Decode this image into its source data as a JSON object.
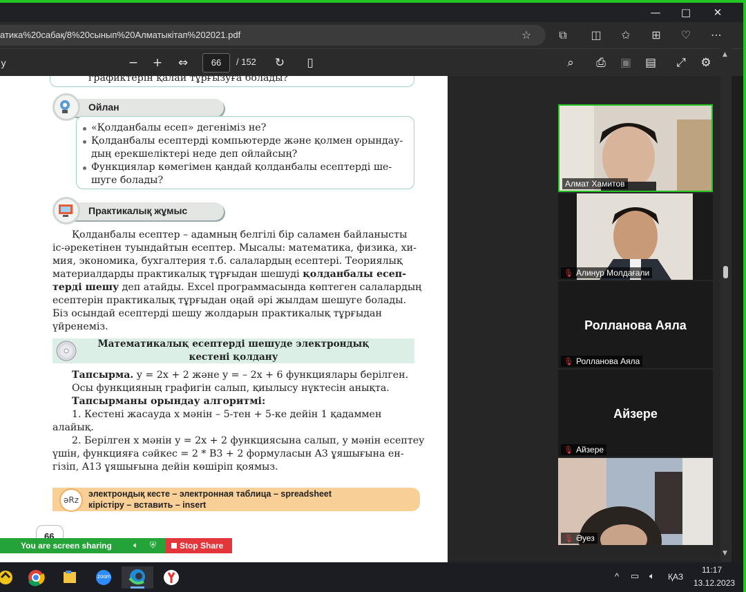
{
  "window": {
    "minimize": "—",
    "maximize": "□",
    "close": "✕"
  },
  "address_bar": {
    "url": "атика%20сабақ/8%20сынып%20Алматыкітап%202021.pdf"
  },
  "pdf_toolbar": {
    "page_current": "66",
    "page_total": "/ 152",
    "left_fragment": "y"
  },
  "document": {
    "top_fragment": "графиктерін қалай тұрғызуға болады?",
    "think_heading": "Ойлан",
    "questions": [
      "«Қолданбалы есеп» дегеніміз не?",
      "Қолданбалы есептерді компьютерде және қолмен орындау-",
      "дың ерекшеліктері неде деп ойлайсың?",
      "Функциялар көмегімен қандай қолданбалы есептерді ше-",
      "шуге болады?"
    ],
    "practical_heading": "Практикалық жұмыс",
    "paragraph": [
      "Қолданбалы есептер – адамның белгілі бір саламен байланысты",
      "іс-әрекетінен туындайтын есептер. Мысалы: математика, физика, хи-",
      "мия, экономика, бухгалтерия т.б. салалардың есептері. Теориялық",
      "материалдарды практикалық тұрғыдан шешуді",
      "қолданбалы есеп-",
      "терді шешу",
      "деп атайды. Excel программасында көптеген салалардың",
      "есептерін практикалық тұрғыдан оңай әрі жылдам шешуге болады.",
      "Біз осындай есептерді шешу жолдарын практикалық тұрғыдан",
      "үйренеміз."
    ],
    "banner_line1": "Математикалық есептерді шешуде электрондық",
    "banner_line2": "кестені қолдану",
    "task_label": "Тапсырма.",
    "task_rest": "y = 2x + 2 және y = – 2x + 6 функциялары берілген.",
    "task_line2": "Осы функцияның графигін салып, қиылысу нүктесін анықта.",
    "algo_heading": "Тапсырманы орындау алгоритмі:",
    "step1_a": "1. Кестені жасауда x мәнін – 5-тен + 5-ке дейін 1 қадаммен",
    "step1_b": "алайық.",
    "step2_a": "2. Берілген x мәнін y = 2x + 2 функциясына салып, y мәнін есептеу",
    "step2_b": "үшін, функцияға сәйкес = 2 * B3 + 2 формуласын A3 ұяшығына ен-",
    "step2_c": "гізіп, A13 ұяшығына дейін көшіріп қоямыз.",
    "vocab_line1": "электрондық кесте – электронная таблица – spreadsheet",
    "vocab_line2": "кірістіру – вставить – insert",
    "vocab_icon_text": "әRz",
    "page_number": "66"
  },
  "participants": [
    {
      "name": "Алмат Хамитов",
      "video": true,
      "muted": false
    },
    {
      "name": "Алинур Молдағали",
      "video": true,
      "muted": true
    },
    {
      "name": "Ролланова Аяла",
      "video": false,
      "muted": true,
      "big_name": "Ролланова Аяла"
    },
    {
      "name": "Айзере",
      "video": false,
      "muted": true,
      "big_name": "Айзере"
    },
    {
      "name": "Әуез",
      "video": true,
      "muted": true
    }
  ],
  "share_bar": {
    "status": "You are screen sharing",
    "stop_label": "Stop Share"
  },
  "taskbar": {
    "language": "ҚАЗ",
    "time": "11:17",
    "date": "13.12.2023",
    "zoom_label": "zoom"
  },
  "colors": {
    "share_green": "#23c423",
    "stop_red": "#e2363b",
    "banner_green": "#dcefe6",
    "vocab_orange": "#f8cf96"
  }
}
